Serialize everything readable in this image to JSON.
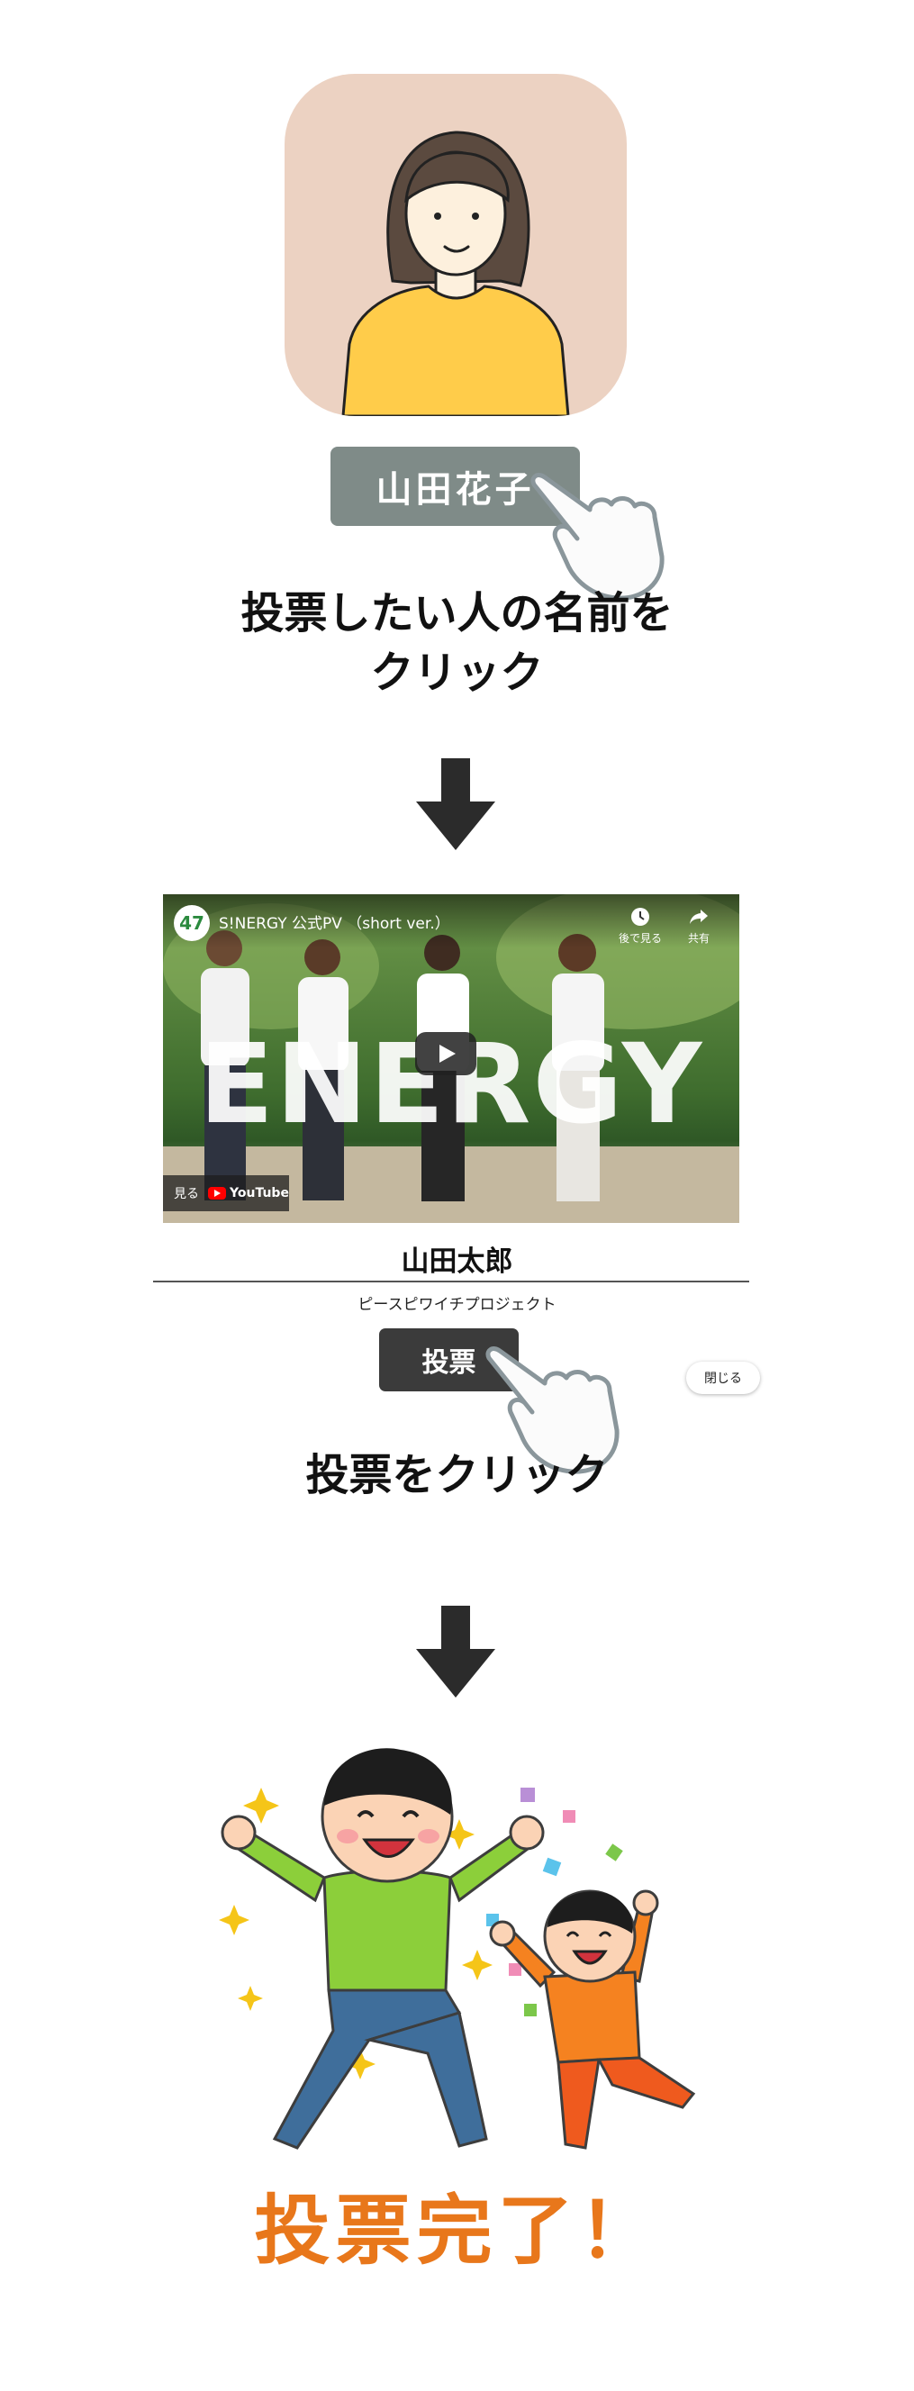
{
  "step1": {
    "candidate_name": "山田花子",
    "instruction_line1": "投票したい人の名前を",
    "instruction_line2": "クリック"
  },
  "step2": {
    "video": {
      "channel_logo": "47",
      "title": "S!NERGY 公式PV （short ver.）",
      "watch_later": "後で見る",
      "share": "共有",
      "overlay_text": "ENERGY",
      "watch_on": "見る",
      "youtube_logo": "YouTube"
    },
    "candidate_name": "山田太郎",
    "organization": "ピースピワイチプロジェクト",
    "vote_button": "投票",
    "close_button": "閉じる",
    "instruction": "投票をクリック"
  },
  "step3": {
    "completion": "投票完了！"
  },
  "colors": {
    "avatar_bg": "#ecd2c2",
    "name_button": "#7f8b88",
    "vote_button": "#3b3b3b",
    "completion_text": "#e8771b"
  },
  "icons": [
    "woman-avatar-icon",
    "pointing-hand-icon",
    "down-arrow-icon",
    "play-icon",
    "clock-icon",
    "share-icon",
    "youtube-icon",
    "celebrating-kids-illustration"
  ]
}
